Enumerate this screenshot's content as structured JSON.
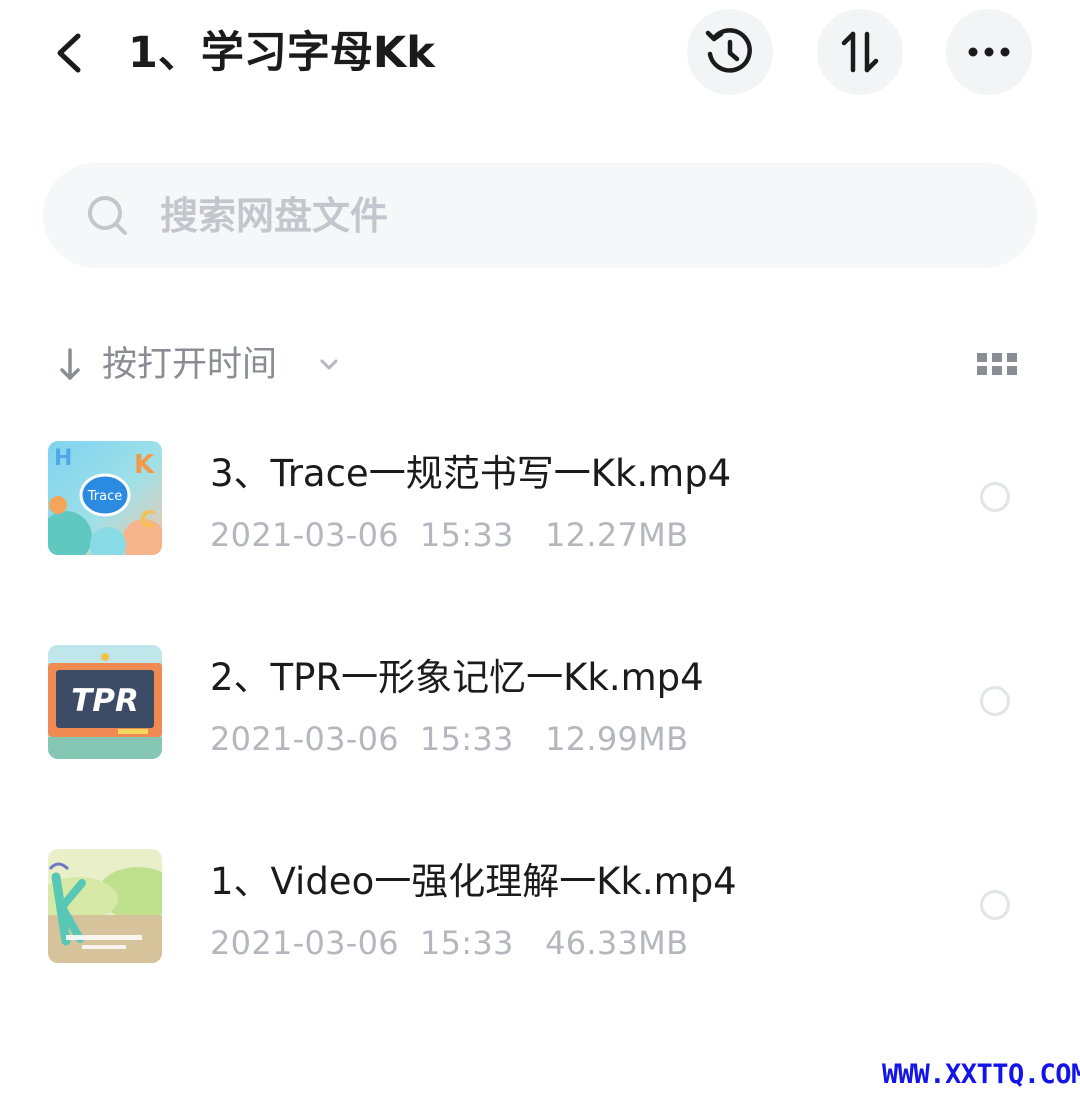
{
  "header": {
    "title": "1、学习字母Kk",
    "back_icon": "chevron-left-icon",
    "history_icon": "history-clock-icon",
    "sort_icon": "sort-arrows-icon",
    "more_icon": "more-dots-icon"
  },
  "search": {
    "placeholder": "搜索网盘文件",
    "icon": "search-icon"
  },
  "sort_bar": {
    "label": "按打开时间",
    "direction_icon": "arrow-down-icon",
    "dropdown_icon": "chevron-down-icon",
    "view_toggle_icon": "grid-view-icon"
  },
  "files": [
    {
      "name": "3、Trace一规范书写一Kk.mp4",
      "date": "2021-03-06",
      "time": "15:33",
      "size": "12.27MB",
      "thumb_label": "Trace",
      "thumb_letters": [
        "H",
        "K",
        "C"
      ]
    },
    {
      "name": "2、TPR一形象记忆一Kk.mp4",
      "date": "2021-03-06",
      "time": "15:33",
      "size": "12.99MB",
      "thumb_label": "TPR"
    },
    {
      "name": "1、Video一强化理解一Kk.mp4",
      "date": "2021-03-06",
      "time": "15:33",
      "size": "46.33MB"
    }
  ],
  "watermark": "WWW.XXTTQ.COM",
  "colors": {
    "title": "#1b1b1b",
    "secondary": "#8a8d93",
    "meta": "#b4b7bd",
    "button_bg": "#f3f4f6",
    "search_bg": "#f6f7f9",
    "watermark": "#1414e8"
  }
}
